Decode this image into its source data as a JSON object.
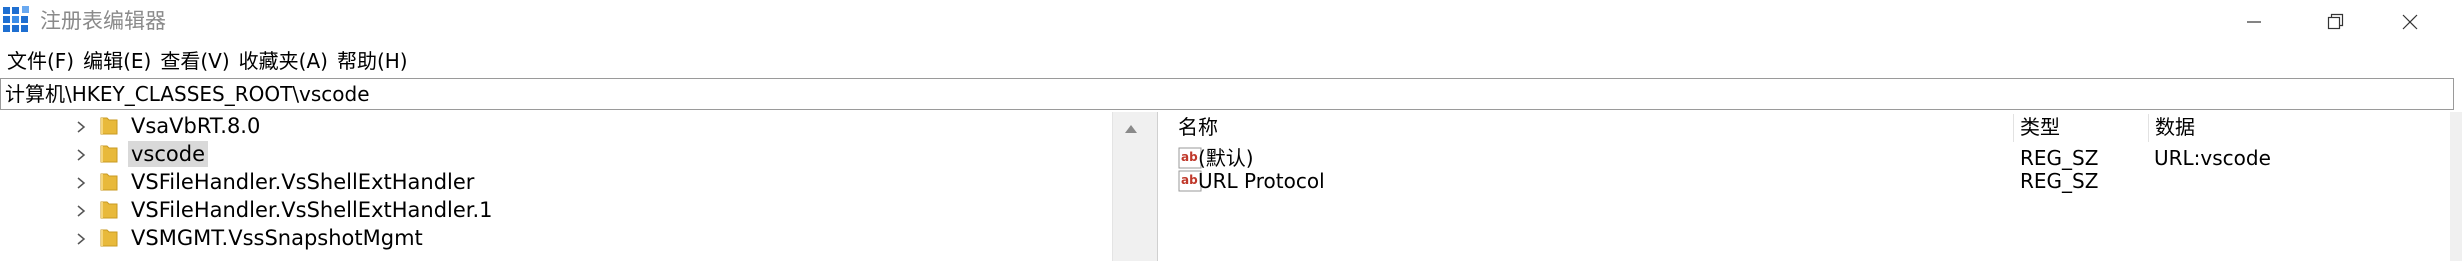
{
  "window": {
    "title": "注册表编辑器",
    "minimize_icon": "minimize-icon",
    "maximize_icon": "restore-icon",
    "close_icon": "close-icon"
  },
  "menu": [
    {
      "label": "文件(F)"
    },
    {
      "label": "编辑(E)"
    },
    {
      "label": "查看(V)"
    },
    {
      "label": "收藏夹(A)"
    },
    {
      "label": "帮助(H)"
    }
  ],
  "address": {
    "path": "计算机\\HKEY_CLASSES_ROOT\\vscode"
  },
  "tree": {
    "items": [
      {
        "label": "VsaVbRT.8.0",
        "selected": false
      },
      {
        "label": "vscode",
        "selected": true
      },
      {
        "label": "VSFileHandler.VsShellExtHandler",
        "selected": false
      },
      {
        "label": "VSFileHandler.VsShellExtHandler.1",
        "selected": false
      },
      {
        "label": "VSMGMT.VssSnapshotMgmt",
        "selected": false
      }
    ]
  },
  "values": {
    "headers": {
      "name": "名称",
      "type": "类型",
      "data": "数据"
    },
    "rows": [
      {
        "name": "(默认)",
        "type": "REG_SZ",
        "data": "URL:vscode",
        "icon": "reg-string-icon"
      },
      {
        "name": "URL Protocol",
        "type": "REG_SZ",
        "data": "",
        "icon": "reg-string-icon"
      }
    ]
  },
  "colors": {
    "folder": "#e8b93b",
    "selected_bg": "#d9d9d9",
    "reg_icon_red": "#c0392b"
  }
}
